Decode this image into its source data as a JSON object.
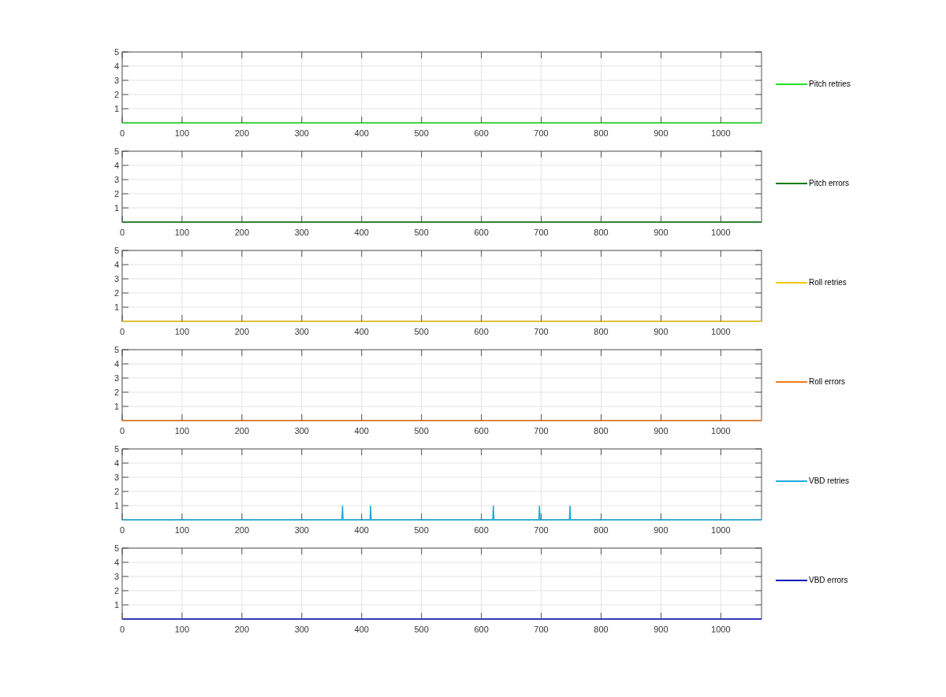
{
  "plots": [
    {
      "chart_data": {
        "type": "line",
        "grid": true,
        "xlim": [
          0,
          1068
        ],
        "ylim": [
          0,
          5
        ],
        "xticks": [
          0,
          100,
          200,
          300,
          400,
          500,
          600,
          700,
          800,
          900,
          1000
        ],
        "yticks": [
          1,
          2,
          3,
          4,
          5
        ],
        "x": [
          0,
          1068
        ],
        "series": [
          {
            "name": "Pitch retries",
            "color": "#22e022",
            "values": [
              0,
              0
            ]
          }
        ]
      }
    },
    {
      "chart_data": {
        "type": "line",
        "grid": true,
        "xlim": [
          0,
          1068
        ],
        "ylim": [
          0,
          5
        ],
        "xticks": [
          0,
          100,
          200,
          300,
          400,
          500,
          600,
          700,
          800,
          900,
          1000
        ],
        "yticks": [
          1,
          2,
          3,
          4,
          5
        ],
        "x": [
          0,
          1068
        ],
        "series": [
          {
            "name": "Pitch errors",
            "color": "#0a7a12",
            "values": [
              0,
              0
            ]
          }
        ]
      }
    },
    {
      "chart_data": {
        "type": "line",
        "grid": true,
        "xlim": [
          0,
          1068
        ],
        "ylim": [
          0,
          5
        ],
        "xticks": [
          0,
          100,
          200,
          300,
          400,
          500,
          600,
          700,
          800,
          900,
          1000
        ],
        "yticks": [
          1,
          2,
          3,
          4,
          5
        ],
        "x": [
          0,
          1068
        ],
        "series": [
          {
            "name": "Roll retries",
            "color": "#f2c913",
            "values": [
              0,
              0
            ]
          }
        ]
      }
    },
    {
      "chart_data": {
        "type": "line",
        "grid": true,
        "xlim": [
          0,
          1068
        ],
        "ylim": [
          0,
          5
        ],
        "xticks": [
          0,
          100,
          200,
          300,
          400,
          500,
          600,
          700,
          800,
          900,
          1000
        ],
        "yticks": [
          1,
          2,
          3,
          4,
          5
        ],
        "x": [
          0,
          1068
        ],
        "series": [
          {
            "name": "Roll errors",
            "color": "#ec7d1c",
            "values": [
              0,
              0
            ]
          }
        ]
      }
    },
    {
      "chart_data": {
        "type": "line",
        "grid": true,
        "xlim": [
          0,
          1068
        ],
        "ylim": [
          0,
          5
        ],
        "xticks": [
          0,
          100,
          200,
          300,
          400,
          500,
          600,
          700,
          800,
          900,
          1000
        ],
        "yticks": [
          1,
          2,
          3,
          4,
          5
        ],
        "x": [
          0,
          367,
          368,
          369,
          414,
          415,
          416,
          619,
          620,
          621,
          696,
          697,
          698,
          747,
          748,
          749,
          1068
        ],
        "series": [
          {
            "name": "VBD retries",
            "color": "#1aaee0",
            "values": [
              0,
              0,
              1,
              0,
              0,
              1,
              0,
              0,
              1,
              0,
              0,
              1,
              0,
              0,
              1,
              0,
              0
            ]
          }
        ]
      }
    },
    {
      "chart_data": {
        "type": "line",
        "grid": true,
        "xlim": [
          0,
          1068
        ],
        "ylim": [
          0,
          5
        ],
        "xticks": [
          0,
          100,
          200,
          300,
          400,
          500,
          600,
          700,
          800,
          900,
          1000
        ],
        "yticks": [
          1,
          2,
          3,
          4,
          5
        ],
        "x": [
          0,
          1068
        ],
        "series": [
          {
            "name": "VBD errors",
            "color": "#0c16b8",
            "values": [
              0,
              0
            ]
          }
        ]
      }
    }
  ]
}
